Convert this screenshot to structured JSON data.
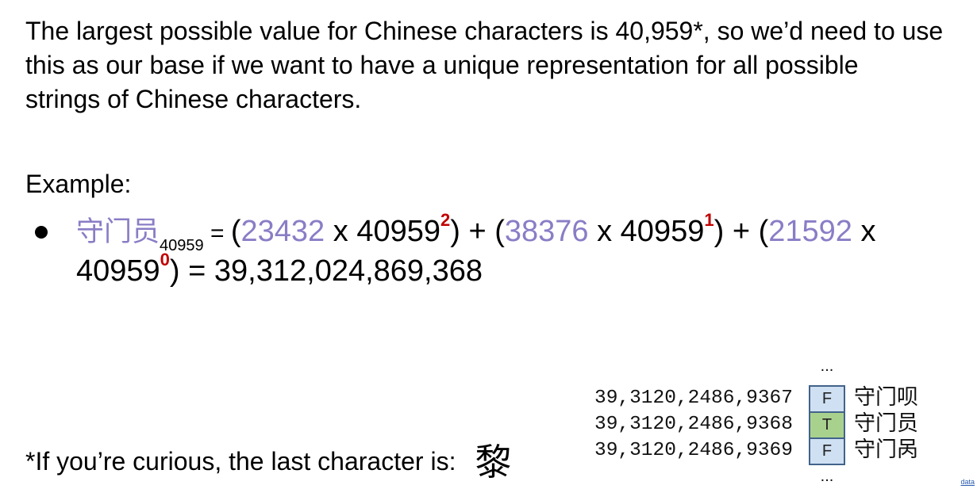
{
  "intro": {
    "lines": [
      "The largest possible value for Chinese characters is 40,959*, so we’d need to use",
      "this as our base if we want to have a unique representation for all possible",
      "strings of Chinese characters."
    ]
  },
  "example": {
    "label": "Example:",
    "equation": {
      "word": "守门员",
      "word_base": "40959",
      "symbols": {
        "equals": "=",
        "open": "(",
        "close": ")",
        "times": "x",
        "plus": "+"
      },
      "terms": [
        {
          "code": "23432",
          "base": "40959",
          "exponent": "2"
        },
        {
          "code": "38376",
          "base": "40959",
          "exponent": "1"
        },
        {
          "code": "21592",
          "base": "40959",
          "exponent": "0"
        }
      ],
      "result": "39,312,024,869,368"
    }
  },
  "lookup_table": {
    "ellipsis_top": "...",
    "rows": [
      {
        "value": "39,3120,2486,9367",
        "flag": "F",
        "word": "守门呗"
      },
      {
        "value": "39,3120,2486,9368",
        "flag": "T",
        "word": "守门员"
      },
      {
        "value": "39,3120,2486,9369",
        "flag": "F",
        "word": "守门呙"
      }
    ],
    "ellipsis_bottom": "..."
  },
  "footnote": {
    "text": "*If you’re curious, the last character is:",
    "last_character": "黎"
  },
  "corner_link": {
    "label": "data"
  },
  "colors": {
    "text": "#000000",
    "code_purple": "#8a7dc6",
    "exponent_red": "#c00000",
    "false_fill": "#cfe0f3",
    "true_fill": "#a9d18e",
    "cell_border": "#41638a",
    "link": "#2a5db0"
  }
}
